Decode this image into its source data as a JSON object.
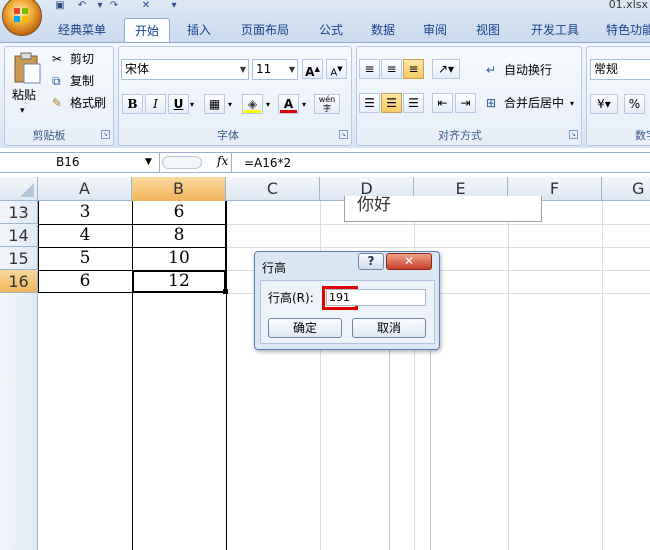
{
  "window": {
    "filename": "01.xlsx"
  },
  "tabs": [
    "经典菜单",
    "开始",
    "插入",
    "页面布局",
    "公式",
    "数据",
    "审阅",
    "视图",
    "开发工具",
    "特色功能"
  ],
  "clipboard": {
    "paste": "粘贴",
    "cut": "剪切",
    "copy": "复制",
    "format_painter": "格式刷",
    "label": "剪贴板"
  },
  "font": {
    "name": "宋体",
    "size": "11",
    "bold": "B",
    "italic": "I",
    "underline": "U",
    "fill_color_letter": "A",
    "phonetic": "wén",
    "label": "字体"
  },
  "alignment": {
    "wrap_text": "自动换行",
    "merge_center": "合并后居中",
    "label": "对齐方式"
  },
  "number": {
    "format": "常规",
    "percent": "%",
    "label": "数字"
  },
  "formula_bar": {
    "name_box": "B16",
    "fx": "fx",
    "formula": "=A16*2"
  },
  "columns": [
    "A",
    "B",
    "C",
    "D",
    "E",
    "F",
    "G"
  ],
  "rows": [
    {
      "num": "13",
      "a": "3",
      "b": "6"
    },
    {
      "num": "14",
      "a": "4",
      "b": "8"
    },
    {
      "num": "15",
      "a": "5",
      "b": "10"
    },
    {
      "num": "16",
      "a": "6",
      "b": "12"
    }
  ],
  "textbox_text": "你好",
  "dialog": {
    "title": "行高",
    "help": "?",
    "field_label": "行高(R):",
    "field_value": "191",
    "ok": "确定",
    "cancel": "取消"
  },
  "colors": {
    "accent_selected": "#f1b55b",
    "highlight_box": "#e00000"
  }
}
